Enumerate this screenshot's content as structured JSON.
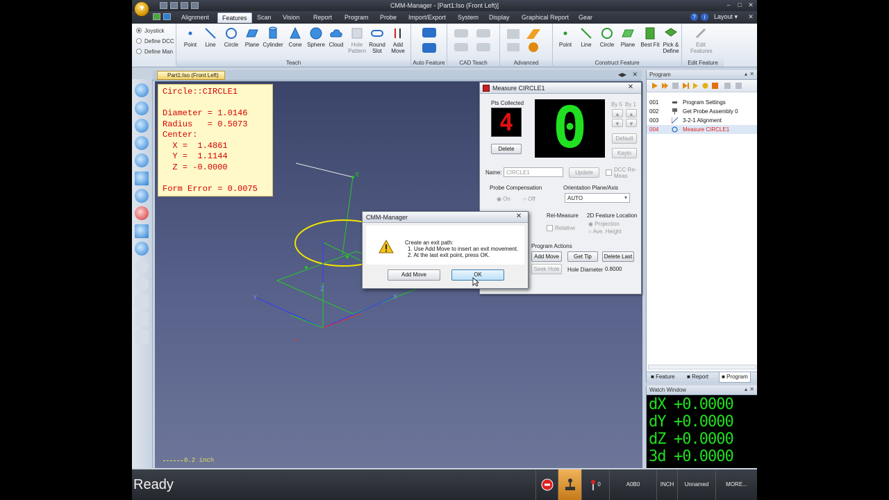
{
  "app_title": "CMM-Manager - [Part1:Iso (Front Left)]",
  "menu": {
    "tabs": [
      "Alignment",
      "Features",
      "Scan",
      "Vision",
      "Report",
      "Program",
      "Probe",
      "Import/Export",
      "System",
      "Display",
      "Graphical Report",
      "Gear"
    ],
    "active_tab": "Features",
    "layout_label": "Layout"
  },
  "ribbon": {
    "modes": [
      "Joystick",
      "Define DCC",
      "Define Man"
    ],
    "teach_buttons": [
      "Point",
      "Line",
      "Circle",
      "Plane",
      "Cylinder",
      "Cone",
      "Sphere",
      "Cloud",
      "Hole Pattern",
      "Round Slot",
      "Add Move"
    ],
    "construct_buttons": [
      "Point",
      "Line",
      "Circle",
      "Plane",
      "Best Fit",
      "Pick & Define"
    ],
    "edit_button": "Edit Features",
    "groups": [
      "Teach",
      "Auto Feature",
      "CAD Teach",
      "Advanced",
      "Construct Feature",
      "Edit Feature"
    ]
  },
  "viewport": {
    "tab_label": "Part1:Iso (Front Left)",
    "readout": {
      "title": "Circle::CIRCLE1",
      "diameter": "Diameter = 1.0146",
      "radius": "Radius   = 0.5073",
      "center": "Center:",
      "x": "  X =  1.4861",
      "y": "  Y =  1.1144",
      "z": "  Z = -0.0000",
      "form_error": "Form Error = 0.0075"
    },
    "scale": "0.2 inch",
    "axis_labels": [
      "Y",
      "X",
      "Z",
      "E"
    ]
  },
  "measure_dialog": {
    "title": "Measure CIRCLE1",
    "pts_collected_label": "Pts Collected",
    "pts_collected": "4",
    "big_counter": "0",
    "by5": "By 5",
    "by1": "By 1",
    "delete": "Delete",
    "default": "Default",
    "keyin": "Keyin",
    "name_label": "Name:",
    "name_value": "CIRCLE1",
    "update": "Update",
    "dcc_remeas": "DCC Re-Meas",
    "probe_comp_label": "Probe Compensation",
    "on": "On",
    "off": "Off",
    "orientation_label": "Orientation Plane/Axis",
    "orientation_value": "AUTO",
    "rel_measure_label": "Rel-Measure",
    "relative": "Relative",
    "feature_loc_label": "2D Feature Location",
    "projection": "Projection",
    "ave_height": "Ave. Height",
    "program_actions_label": "Program Actions",
    "add_move": "Add Move",
    "get_tip": "Get Tip",
    "delete_last": "Delete Last",
    "seek_hole": "Seek Hole",
    "hole_diameter_label": "Hole Diameter",
    "hole_diameter": "0.8000"
  },
  "message_dialog": {
    "title": "CMM-Manager",
    "line1": "Create an exit path:",
    "line2": "1. Use Add Move to insert an exit movement.",
    "line3": "2. At the last exit point, press OK.",
    "add_move": "Add Move",
    "ok": "OK"
  },
  "program_panel": {
    "title": "Program",
    "rows": [
      {
        "num": "001",
        "text": "Program Settings"
      },
      {
        "num": "002",
        "text": "Get Probe Assembly 0"
      },
      {
        "num": "003",
        "text": "3-2-1 Alignment"
      },
      {
        "num": "004",
        "text": "Measure CIRCLE1"
      }
    ],
    "tabs": [
      "Feature",
      "Report",
      "Program"
    ]
  },
  "watch_window": {
    "title": "Watch Window",
    "rows": [
      {
        "label": "dX",
        "value": "+0.0000"
      },
      {
        "label": "dY",
        "value": "+0.0000"
      },
      {
        "label": "dZ",
        "value": "+0.0000"
      },
      {
        "label": "3d",
        "value": "+0.0000"
      }
    ]
  },
  "status_bar": {
    "status": "Ready",
    "probe_count": "0",
    "probe_name": "A0B0",
    "units": "INCH",
    "file": "Unnamed",
    "more": "MORE..."
  },
  "colors": {
    "readout_text": "#d40000",
    "watch_text": "#1fe01f",
    "selected_row": "#e0201a",
    "viewport_top": "#3b4468",
    "circle_yellow": "#f2e400",
    "wire_green": "#28c828"
  }
}
